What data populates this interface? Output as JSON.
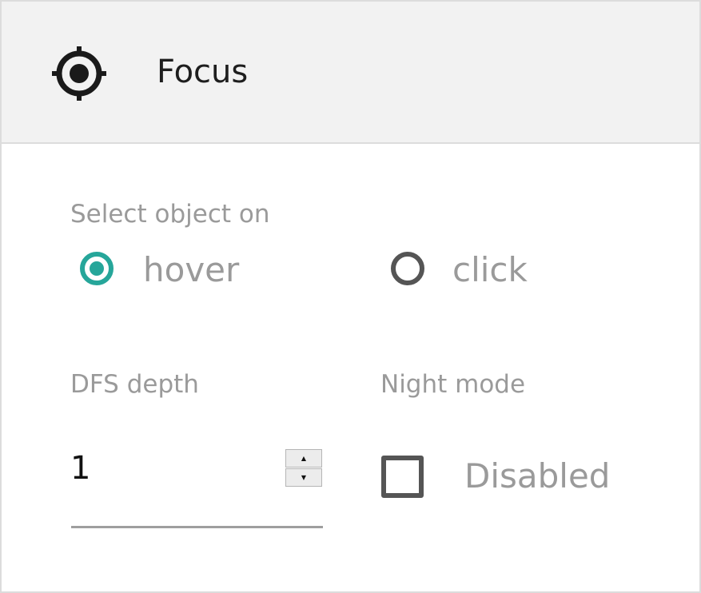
{
  "header": {
    "title": "Focus",
    "icon": "crosshair-icon"
  },
  "select_on": {
    "label": "Select object on",
    "options": [
      {
        "label": "hover",
        "selected": true
      },
      {
        "label": "click",
        "selected": false
      }
    ],
    "accent_color": "#26a69a"
  },
  "dfs_depth": {
    "label": "DFS depth",
    "value": "1",
    "up": "▲",
    "down": "▼"
  },
  "night_mode": {
    "label": "Night mode",
    "checked": false,
    "state_label": "Disabled"
  }
}
